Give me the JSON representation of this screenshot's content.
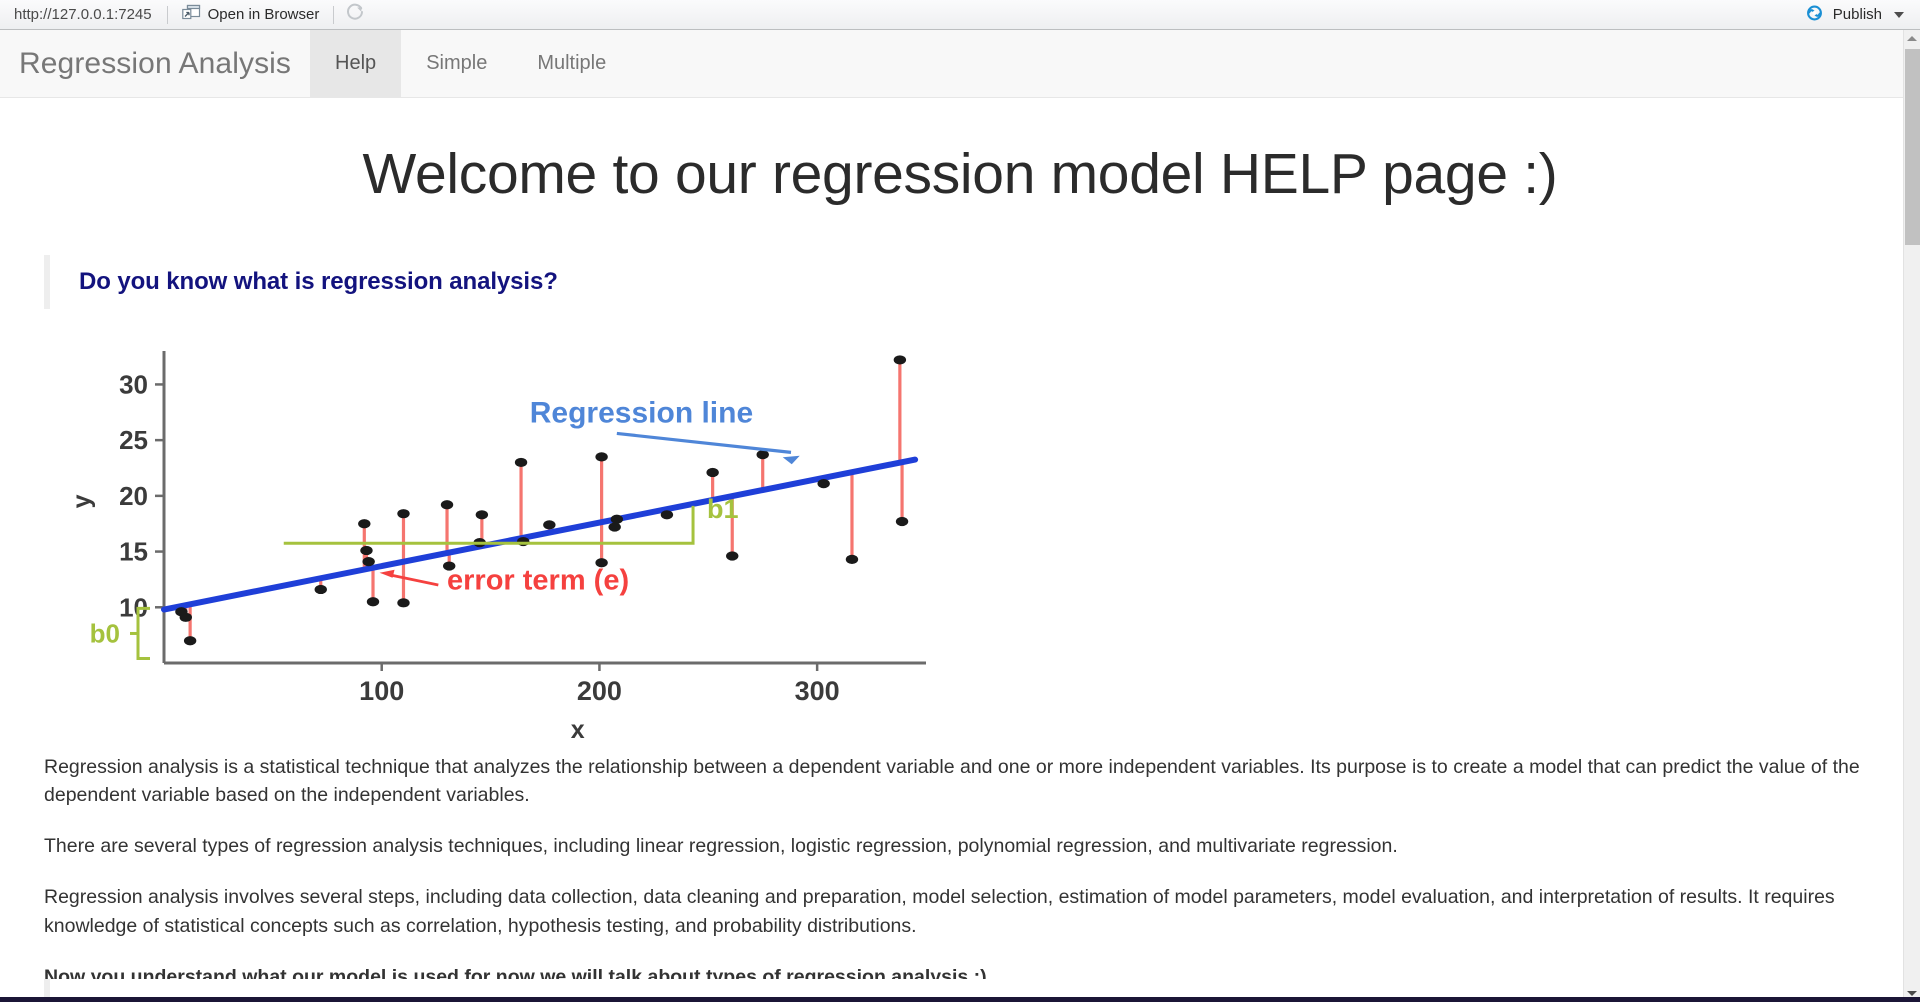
{
  "viewer_toolbar": {
    "url": "http://127.0.0.1:7245",
    "open_in_browser_label": "Open in Browser",
    "open_in_browser_icon": "external-window-icon",
    "refresh_icon": "refresh-icon",
    "publish_label": "Publish",
    "publish_icon": "publish-icon",
    "publish_caret_icon": "chevron-down-icon"
  },
  "navbar": {
    "brand": "Regression Analysis",
    "tabs": [
      {
        "label": "Help",
        "active": true
      },
      {
        "label": "Simple",
        "active": false
      },
      {
        "label": "Multiple",
        "active": false
      }
    ]
  },
  "main": {
    "title": "Welcome to our regression model HELP page :)",
    "section_heading": "Do you know what is regression analysis?",
    "paragraphs": [
      "Regression analysis is a statistical technique that analyzes the relationship between a dependent variable and one or more independent variables. Its purpose is to create a model that can predict the value of the dependent variable based on the independent variables.",
      "There are several types of regression analysis techniques, including linear regression, logistic regression, polynomial regression, and multivariate regression.",
      "Regression analysis involves several steps, including data collection, data cleaning and preparation, model selection, estimation of model parameters, model evaluation, and interpretation of results. It requires knowledge of statistical concepts such as correlation, hypothesis testing, and probability distributions."
    ],
    "closing_bold": "Now you understand what our model is used for now we will talk about types of regression analysis :)"
  },
  "chart_data": {
    "type": "scatter",
    "title": "",
    "xlabel": "x",
    "ylabel": "y",
    "xlim": [
      0,
      350
    ],
    "ylim": [
      5,
      33
    ],
    "xticks": [
      100,
      200,
      300
    ],
    "yticks": [
      10,
      15,
      20,
      25,
      30
    ],
    "grid": false,
    "legend_position": "none",
    "regression_line": {
      "label": "Regression line",
      "color": "#1f3fd8",
      "intercept": 9.8,
      "slope": 0.039,
      "x_start": 0,
      "x_end": 345
    },
    "points": [
      {
        "x": 8,
        "y": 9.6,
        "fit": 10.1
      },
      {
        "x": 10,
        "y": 9.1,
        "fit": 10.2
      },
      {
        "x": 12,
        "y": 7.0,
        "fit": 10.3
      },
      {
        "x": 72,
        "y": 11.6,
        "fit": 12.6
      },
      {
        "x": 92,
        "y": 17.5,
        "fit": 13.4
      },
      {
        "x": 93,
        "y": 15.1,
        "fit": 13.4
      },
      {
        "x": 94,
        "y": 14.1,
        "fit": 13.5
      },
      {
        "x": 96,
        "y": 10.5,
        "fit": 13.5
      },
      {
        "x": 110,
        "y": 18.4,
        "fit": 14.1
      },
      {
        "x": 110,
        "y": 10.4,
        "fit": 14.1
      },
      {
        "x": 130,
        "y": 19.2,
        "fit": 14.9
      },
      {
        "x": 131,
        "y": 13.7,
        "fit": 14.9
      },
      {
        "x": 146,
        "y": 18.3,
        "fit": 15.5
      },
      {
        "x": 145,
        "y": 15.8,
        "fit": 15.5
      },
      {
        "x": 164,
        "y": 23.0,
        "fit": 16.2
      },
      {
        "x": 165,
        "y": 15.9,
        "fit": 16.2
      },
      {
        "x": 177,
        "y": 17.4,
        "fit": 16.7
      },
      {
        "x": 201,
        "y": 23.5,
        "fit": 17.6
      },
      {
        "x": 201,
        "y": 14.0,
        "fit": 17.6
      },
      {
        "x": 208,
        "y": 17.9,
        "fit": 17.9
      },
      {
        "x": 207,
        "y": 17.2,
        "fit": 17.9
      },
      {
        "x": 231,
        "y": 18.3,
        "fit": 18.8
      },
      {
        "x": 252,
        "y": 22.1,
        "fit": 19.6
      },
      {
        "x": 261,
        "y": 14.6,
        "fit": 20.0
      },
      {
        "x": 275,
        "y": 23.7,
        "fit": 20.5
      },
      {
        "x": 303,
        "y": 21.1,
        "fit": 21.6
      },
      {
        "x": 316,
        "y": 14.3,
        "fit": 22.1
      },
      {
        "x": 338,
        "y": 32.2,
        "fit": 23.0
      },
      {
        "x": 339,
        "y": 17.7,
        "fit": 23.0
      }
    ],
    "annotations": [
      {
        "name": "regression-line-label",
        "text": "Regression line",
        "color": "#4f86d8"
      },
      {
        "name": "error-term-label",
        "text": "error term (e)",
        "color": "#f5413f"
      },
      {
        "name": "slope-label",
        "text": "b1",
        "color": "#a5c23e"
      },
      {
        "name": "intercept-label",
        "text": "b0",
        "color": "#a5c23e"
      }
    ],
    "residual_color": "#f5756f",
    "point_color": "#1a1a1a"
  }
}
